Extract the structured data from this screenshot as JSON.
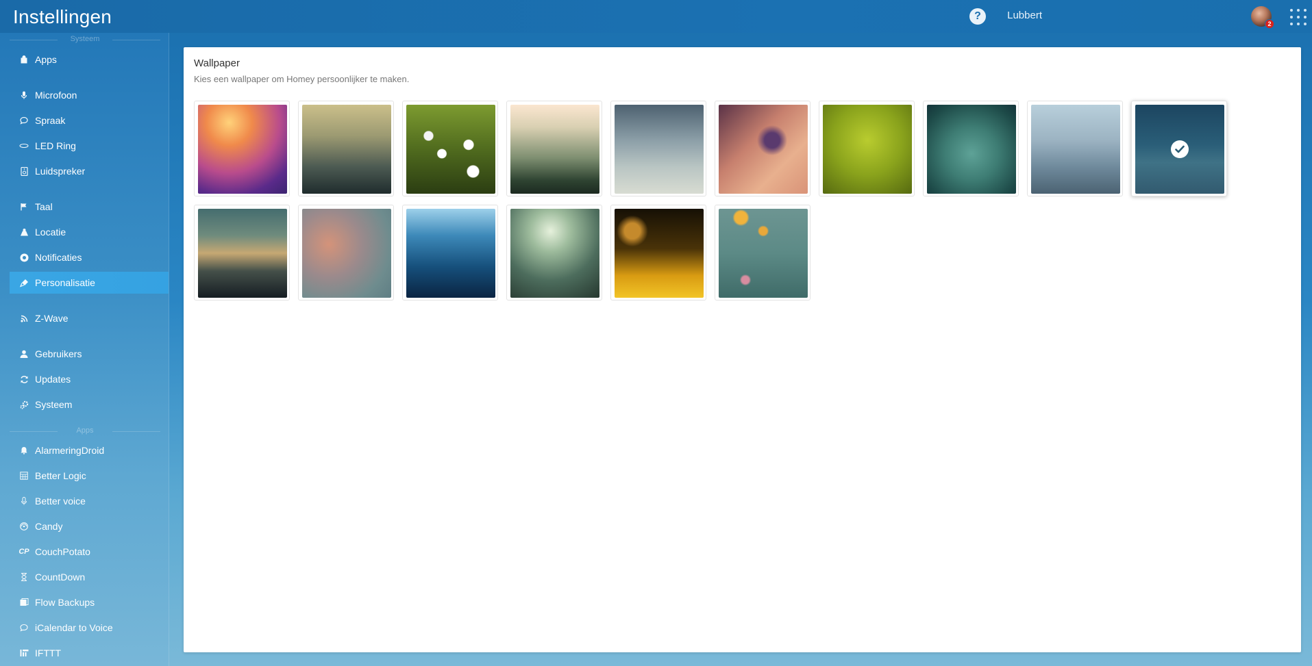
{
  "header": {
    "title": "Instellingen",
    "help_symbol": "?",
    "user_name": "Lubbert",
    "notification_count": "2"
  },
  "sidebar": {
    "section_system": "Systeem",
    "section_apps": "Apps",
    "items": [
      {
        "label": "Apps",
        "icon": "bag-icon"
      },
      {
        "label": "Microfoon",
        "icon": "microphone-icon"
      },
      {
        "label": "Spraak",
        "icon": "speech-bubble-icon"
      },
      {
        "label": "LED Ring",
        "icon": "led-ring-icon"
      },
      {
        "label": "Luidspreker",
        "icon": "speaker-icon"
      },
      {
        "label": "Taal",
        "icon": "flag-icon"
      },
      {
        "label": "Locatie",
        "icon": "location-icon"
      },
      {
        "label": "Notificaties",
        "icon": "notification-icon"
      },
      {
        "label": "Personalisatie",
        "icon": "paint-icon",
        "active": true
      },
      {
        "label": "Z-Wave",
        "icon": "zwave-icon"
      },
      {
        "label": "Gebruikers",
        "icon": "user-icon"
      },
      {
        "label": "Updates",
        "icon": "refresh-icon"
      },
      {
        "label": "Systeem",
        "icon": "gears-icon"
      }
    ],
    "apps": [
      {
        "label": "AlarmeringDroid",
        "icon": "bell-icon"
      },
      {
        "label": "Better Logic",
        "icon": "calculator-icon"
      },
      {
        "label": "Better voice",
        "icon": "microphone-icon"
      },
      {
        "label": "Candy",
        "icon": "candy-icon"
      },
      {
        "label": "CouchPotato",
        "icon": "couchpotato-icon"
      },
      {
        "label": "CountDown",
        "icon": "hourglass-icon"
      },
      {
        "label": "Flow Backups",
        "icon": "backup-icon"
      },
      {
        "label": "iCalendar to Voice",
        "icon": "speech-bubble-icon"
      },
      {
        "label": "IFTTT",
        "icon": "ifttt-icon"
      }
    ]
  },
  "main": {
    "title": "Wallpaper",
    "subtitle": "Kies een wallpaper om Homey persoonlijker te maken.",
    "selected_index": 9,
    "wallpapers": [
      {
        "name": "colorful-bokeh",
        "gradient": "radial-gradient(circle at 35% 20%, #ffd27a 0%, #f08a4b 25%, #b94c8c 55%, #5a2a8a 80%, #3b2470 100%)"
      },
      {
        "name": "olive-dusk",
        "gradient": "linear-gradient(180deg, #cbbf8a 0%, #9c9a72 35%, #4c5a52 70%, #1f2c2d 100%)"
      },
      {
        "name": "daisies",
        "gradient": "radial-gradient(circle at 40% 55%, #ffffff 0 6%, transparent 7%), radial-gradient(circle at 70% 45%, #ffffff 0 6%, transparent 7%), radial-gradient(circle at 25% 35%, #f4f4f4 0 5%, transparent 6%), radial-gradient(circle at 75% 75%, #ffffff 0 6%, transparent 7%), linear-gradient(180deg, #7d9b30 0%, #506b1e 50%, #2b3d12 100%)"
      },
      {
        "name": "grass-field",
        "gradient": "linear-gradient(180deg, #fbe6d0 0%, #d9d0b2 25%, #7d8e70 60%, #2f4432 85%, #1c2a20 100%)"
      },
      {
        "name": "grey-fog",
        "gradient": "linear-gradient(180deg, #4d6170 0%, #8c9fa8 40%, #b9c5c3 70%, #d8dcd2 100%)"
      },
      {
        "name": "purple-flower",
        "gradient": "radial-gradient(circle at 60% 40%, #5a3a6e 0 10%, transparent 20%), linear-gradient(135deg, #5a3247 0%, #c7806e 40%, #e8b08e 70%, #d99378 100%)"
      },
      {
        "name": "green-blur",
        "gradient": "radial-gradient(circle at 50% 40%, #b9cc2f 0%, #8aa31c 50%, #566a10 100%)"
      },
      {
        "name": "teal-glow",
        "gradient": "radial-gradient(circle at 50% 55%, #5ea297 0%, #3e7d74 40%, #1d4a48 80%, #14343a 100%)"
      },
      {
        "name": "rainy-window",
        "gradient": "linear-gradient(180deg, #b8cfdb 0%, #9cb3c2 40%, #6f8a9c 70%, #4b6272 100%)"
      },
      {
        "name": "dark-teal",
        "gradient": "linear-gradient(180deg, #1c4560 0%, #2a5e78 45%, #3f7286 65%, #325a6f 100%)"
      },
      {
        "name": "sunset-horizon",
        "gradient": "linear-gradient(180deg, #456d6f 0%, #6f8b7d 30%, #c6a873 50%, #45504a 70%, #151d22 100%)"
      },
      {
        "name": "warm-bokeh",
        "gradient": "radial-gradient(circle at 30% 40%, #d4937a 0%, #9b8a8c 40%, #6e8c8e 75%, #5f7e84 100%)"
      },
      {
        "name": "blue-ocean",
        "gradient": "linear-gradient(180deg, #9dd0ea 0%, #3d89b9 30%, #16507c 65%, #0a2442 100%)"
      },
      {
        "name": "forest-blur",
        "gradient": "radial-gradient(circle at 45% 25%, #e6f1dc 0%, #9dbb9c 25%, #4d6d5d 60%, #26382f 100%)"
      },
      {
        "name": "wheat-gold",
        "gradient": "radial-gradient(circle at 20% 25%, #c58a2c 0 8%, transparent 16%), linear-gradient(180deg, #161005 0%, #4a3308 45%, #d89b12 75%, #f2c427 100%)"
      },
      {
        "name": "yellow-flowers",
        "gradient": "radial-gradient(circle at 25% 10%, #f0b33c 0 6%, transparent 8%), radial-gradient(circle at 50% 25%, #e8a83a 0 5%, transparent 7%), radial-gradient(circle at 30% 80%, #d78da0 0 4%, transparent 6%), linear-gradient(180deg, #6d9592 0%, #5c8a86 50%, #3f6b68 100%)"
      }
    ]
  }
}
